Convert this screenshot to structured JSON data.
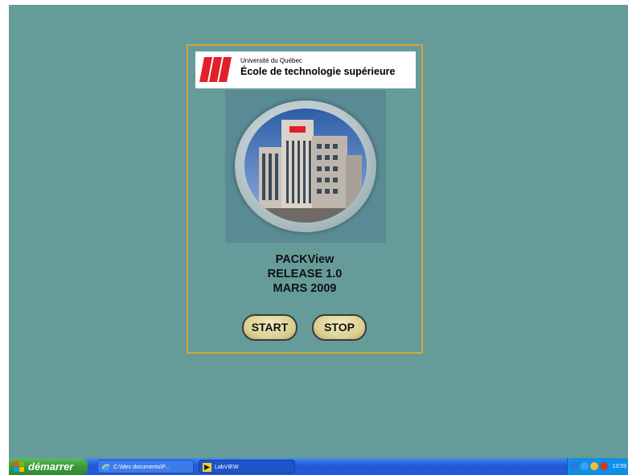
{
  "logo": {
    "line1": "Université du Québec",
    "line2": "École de technologie supérieure"
  },
  "app": {
    "name": "PACKView",
    "release": "RELEASE 1.0",
    "date": "MARS 2009"
  },
  "buttons": {
    "start": "START",
    "stop": "STOP"
  },
  "taskbar": {
    "start_label": "démarrer",
    "tasks": [
      {
        "label": "C:\\Mes documents\\P..."
      },
      {
        "label": "LabVIEW"
      }
    ],
    "clock": "13:59"
  },
  "colors": {
    "desktop": "#659c9a",
    "panel_border": "#d8a23a",
    "logo_red": "#e0202b",
    "button_fill": "#dccf8f"
  }
}
